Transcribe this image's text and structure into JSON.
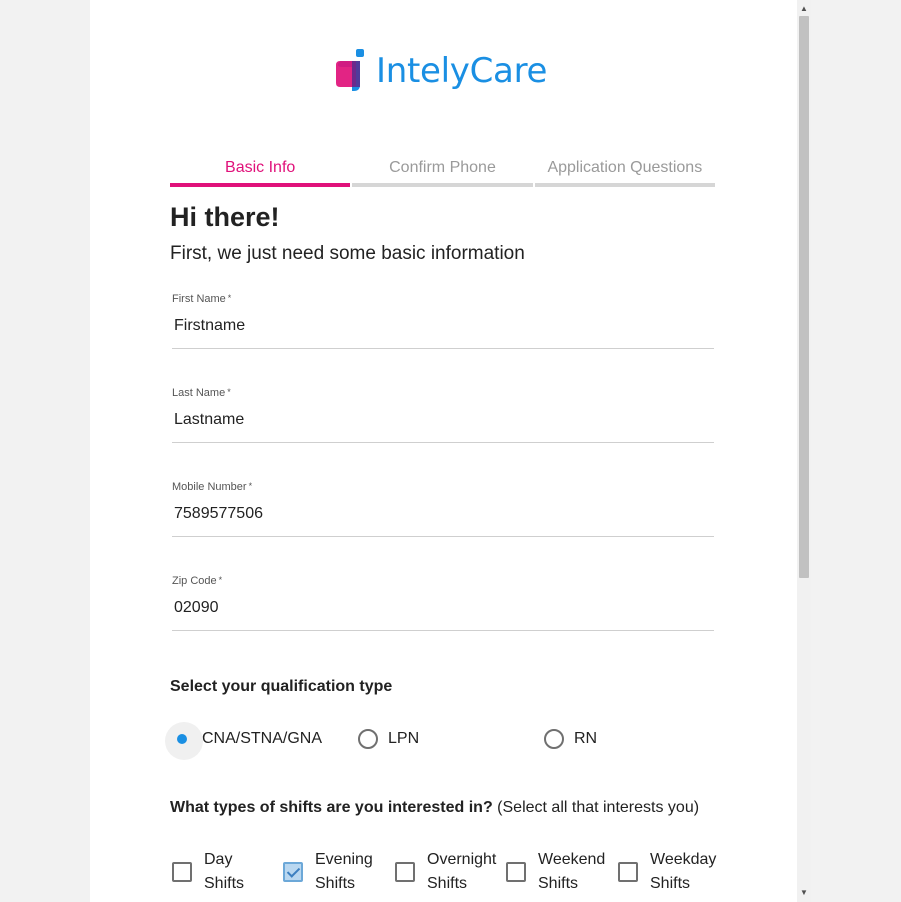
{
  "brand": {
    "name": "IntelyCare",
    "color": "#1a8fe3",
    "accent": "#e0117a"
  },
  "steps": [
    {
      "label": "Basic Info",
      "active": true
    },
    {
      "label": "Confirm Phone",
      "active": false
    },
    {
      "label": "Application Questions",
      "active": false
    }
  ],
  "heading": {
    "title": "Hi there!",
    "subtitle": "First, we just need some basic information"
  },
  "fields": {
    "first_name": {
      "label": "First Name",
      "required": "*",
      "value": "Firstname"
    },
    "last_name": {
      "label": "Last Name",
      "required": "*",
      "value": "Lastname"
    },
    "mobile": {
      "label": "Mobile Number",
      "required": "*",
      "value": "7589577506"
    },
    "zip": {
      "label": "Zip Code",
      "required": "*",
      "value": "02090"
    }
  },
  "qualification": {
    "label": "Select your qualification type",
    "options": [
      {
        "label": "CNA/STNA/GNA",
        "selected": true
      },
      {
        "label": "LPN",
        "selected": false
      },
      {
        "label": "RN",
        "selected": false
      }
    ]
  },
  "shifts": {
    "label": "What types of shifts are you interested in?",
    "hint": "(Select all that interests you)",
    "options": [
      {
        "line1": "Day",
        "line2": "Shifts",
        "checked": false
      },
      {
        "line1": "Evening",
        "line2": "Shifts",
        "checked": true
      },
      {
        "line1": "Overnight",
        "line2": "Shifts",
        "checked": false
      },
      {
        "line1": "Weekend",
        "line2": "Shifts",
        "checked": false
      },
      {
        "line1": "Weekday",
        "line2": "Shifts",
        "checked": false
      }
    ]
  },
  "icons": {
    "scroll_up": "scroll-up-arrow-icon",
    "scroll_down": "scroll-down-arrow-icon",
    "logo": "intelycare-logo-icon"
  }
}
